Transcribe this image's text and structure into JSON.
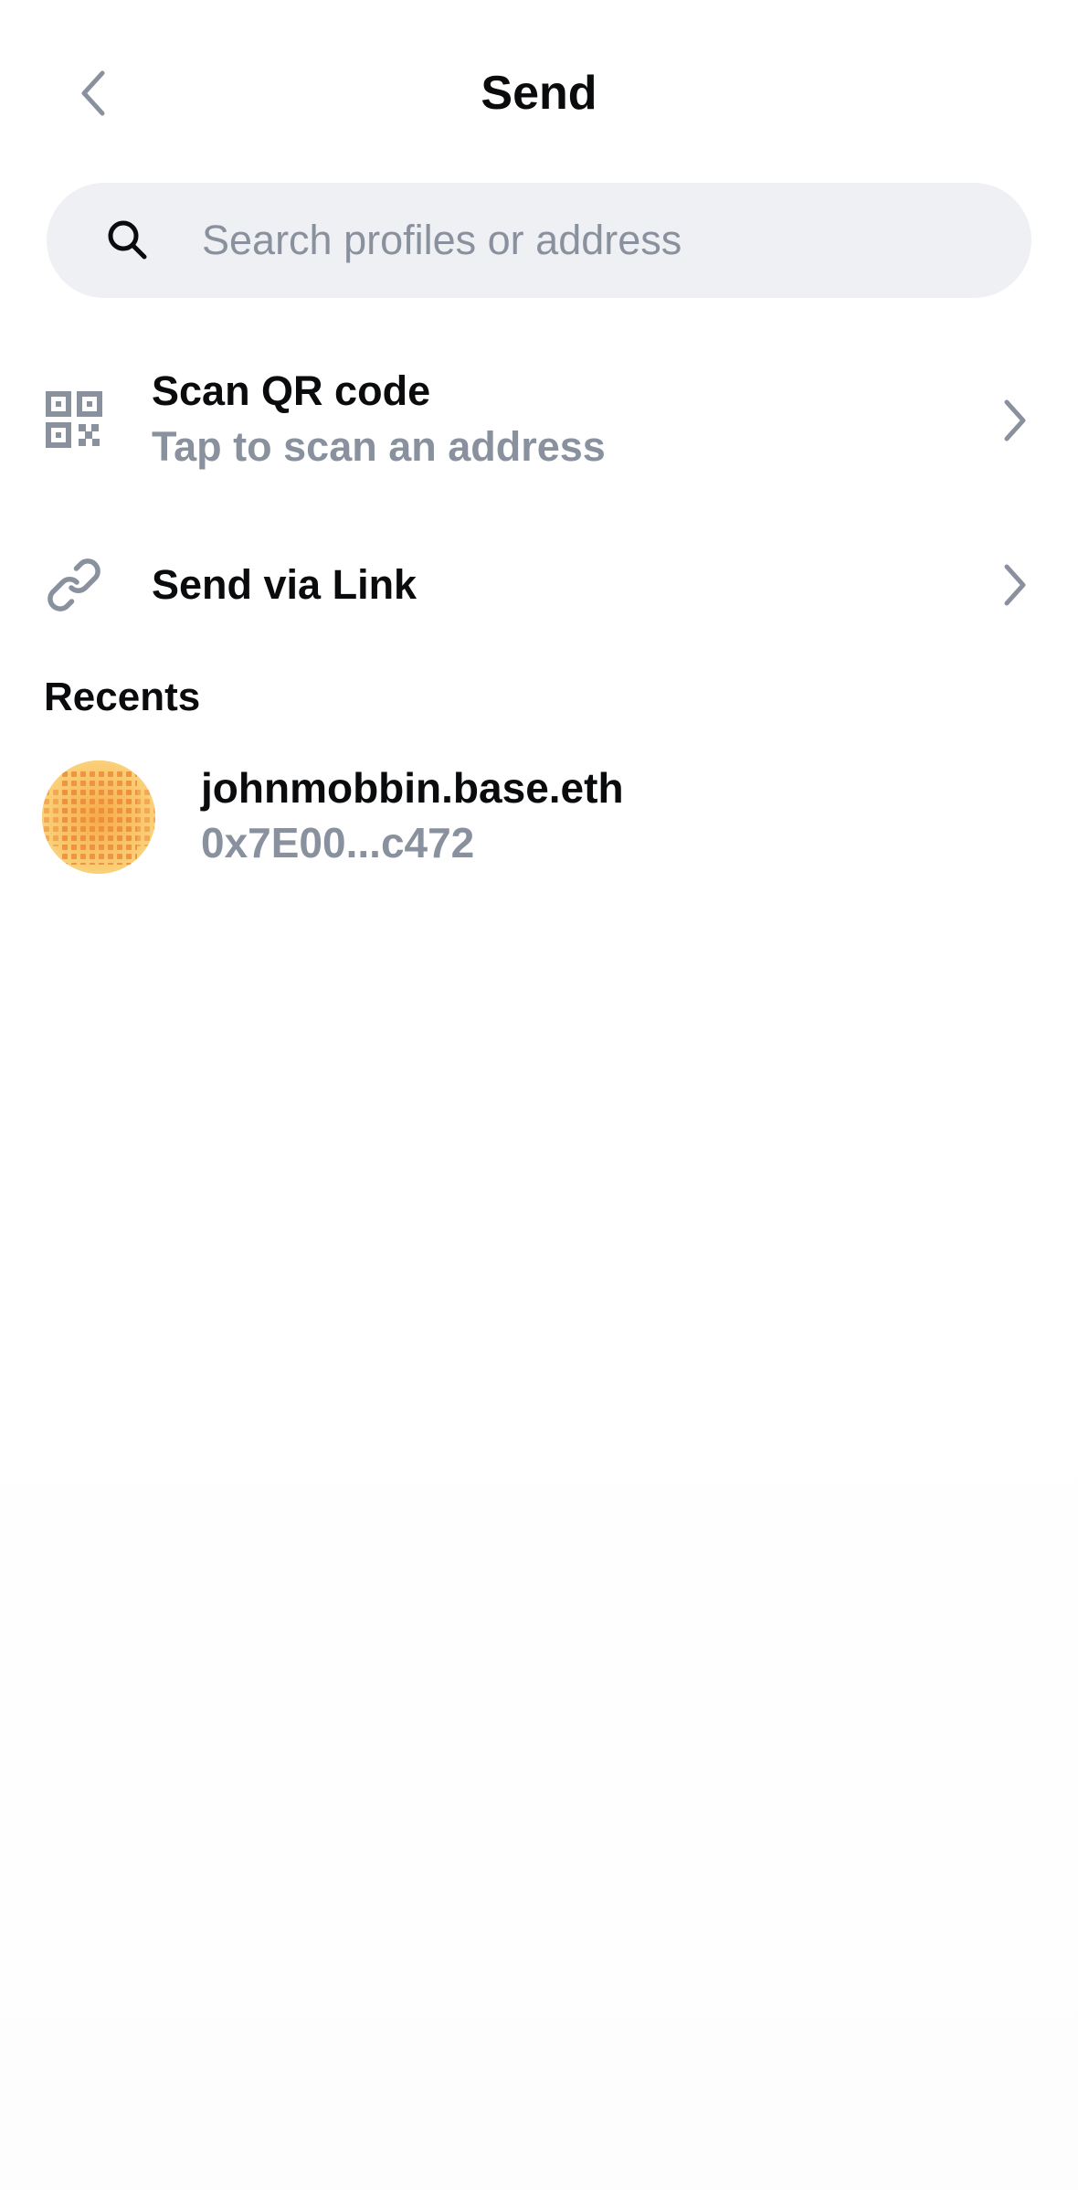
{
  "header": {
    "title": "Send",
    "back_icon": "chevron-left-icon"
  },
  "search": {
    "placeholder": "Search profiles or address",
    "value": "",
    "icon": "search-icon"
  },
  "options": [
    {
      "title": "Scan QR code",
      "subtitle": "Tap to scan an address",
      "icon": "qr-code-icon"
    },
    {
      "title": "Send via Link",
      "icon": "link-icon"
    }
  ],
  "recents": {
    "title": "Recents",
    "items": [
      {
        "name": "johnmobbin.base.eth",
        "address": "0x7E00...c472",
        "avatar_colors": [
          "#f8c45c",
          "#ee8f3a"
        ]
      }
    ]
  },
  "colors": {
    "text_primary": "#0a0b0d",
    "text_secondary": "#8a919e",
    "search_bg": "#eff0f3",
    "icon_gray": "#8a919e"
  }
}
